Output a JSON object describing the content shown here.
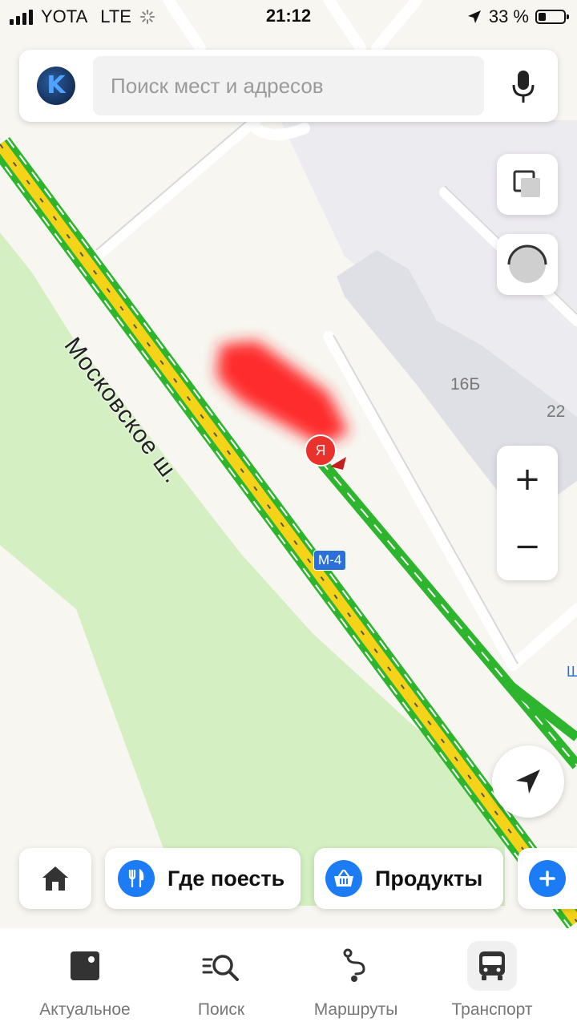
{
  "status_bar": {
    "carrier": "YOTA",
    "network": "LTE",
    "time": "21:12",
    "battery": "33 %",
    "battery_level": 0.33
  },
  "search": {
    "placeholder": "Поиск мест и адресов",
    "avatar_letter": "K",
    "mic_icon": "microphone-icon"
  },
  "map": {
    "street_name": "Московское ш.",
    "route_badge": "М-4",
    "building_labels": [
      "16Б",
      "22"
    ],
    "edge_label": "Ш",
    "marker_letter": "Я",
    "colors": {
      "background": "#f7f6f0",
      "park": "#d4efc2",
      "building": "#e3e3ea",
      "traffic_free": "#2db52d",
      "traffic_slow": "#f5d319",
      "marker": "#e8322b",
      "route_badge": "#2c6fd6"
    }
  },
  "map_controls": {
    "layers_icon": "layers-icon",
    "compass_icon": "compass-icon",
    "zoom_in": "+",
    "zoom_out": "−",
    "locate_icon": "navigation-arrow-icon"
  },
  "chips": [
    {
      "label": "",
      "icon": "home-icon"
    },
    {
      "label": "Где поесть",
      "icon": "fork-knife-icon"
    },
    {
      "label": "Продукты",
      "icon": "basket-icon"
    },
    {
      "label": "",
      "icon": "plus-icon"
    }
  ],
  "tabs": [
    {
      "label": "Актуальное",
      "icon": "news-icon",
      "active": false
    },
    {
      "label": "Поиск",
      "icon": "search-list-icon",
      "active": false
    },
    {
      "label": "Маршруты",
      "icon": "route-icon",
      "active": false
    },
    {
      "label": "Транспорт",
      "icon": "bus-icon",
      "active": true
    }
  ]
}
